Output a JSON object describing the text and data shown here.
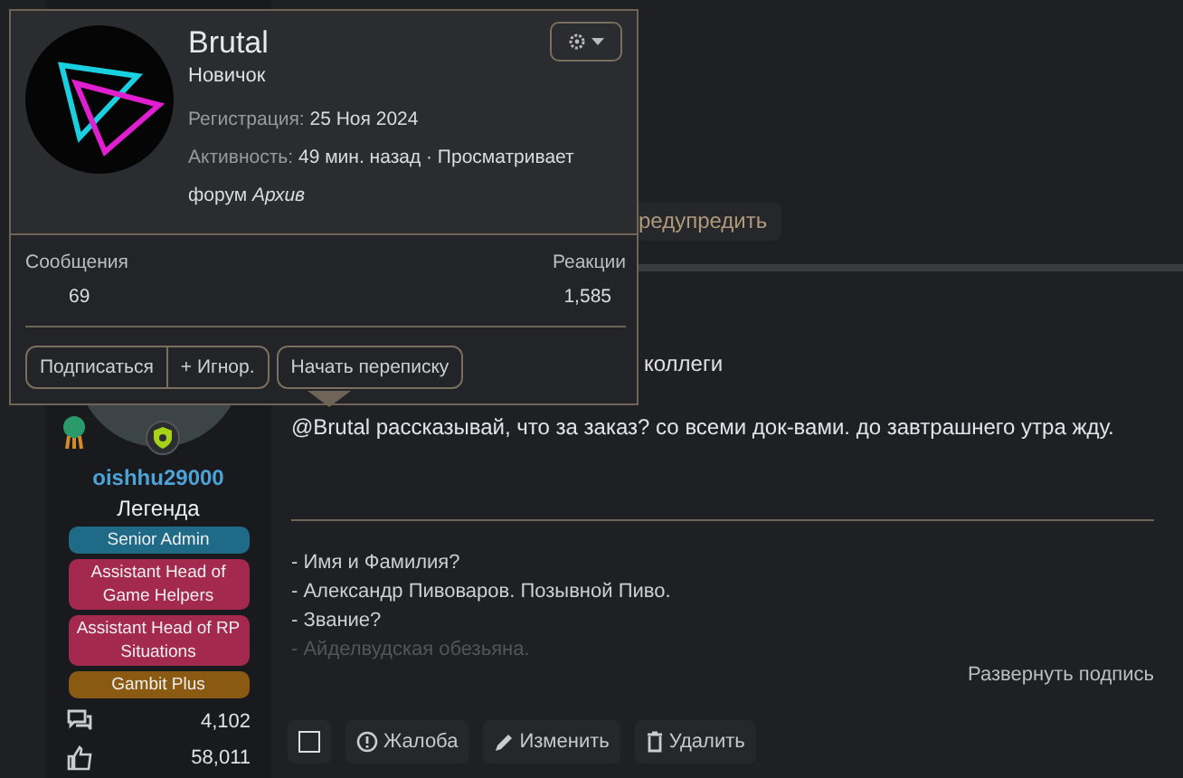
{
  "previous_post": {
    "actions": [
      {
        "label": "редупредить"
      }
    ]
  },
  "post": {
    "author": {
      "name": "oishhu29000",
      "title": "Легенда",
      "banners": [
        {
          "label": "Senior Admin",
          "color": "#1f6a86"
        },
        {
          "label": "Assistant Head of Game Helpers",
          "color": "#a3294f"
        },
        {
          "label": "Assistant Head of RP Situations",
          "color": "#a3294f"
        },
        {
          "label": "Gambit Plus",
          "color": "#8a5a12"
        }
      ],
      "stats": [
        {
          "kind": "messages",
          "value": "4,102"
        },
        {
          "kind": "likes",
          "value": "58,011"
        }
      ]
    },
    "text_fragment": "коллеги",
    "message": "@Brutal рассказывай, что за заказ? со всеми док-вами. до завтрашнего утра жду.",
    "signature": [
      {
        "text": "- Имя и Фамилия?",
        "faded": false
      },
      {
        "text": "- Александр Пивоваров. Позывной Пиво.",
        "faded": false
      },
      {
        "text": "- Звание?",
        "faded": false
      },
      {
        "text": "- Айделвудская обезьяна.",
        "faded": true
      }
    ],
    "expand_signature": "Развернуть подпись",
    "actions": [
      {
        "kind": "checkbox",
        "checked": false
      },
      {
        "kind": "report",
        "label": "Жалоба"
      },
      {
        "kind": "edit",
        "label": "Изменить"
      },
      {
        "kind": "delete",
        "label": "Удалить"
      }
    ]
  },
  "member_card": {
    "name": "Brutal",
    "title": "Новичок",
    "registration": {
      "label": "Регистрация:",
      "value": "25 Ноя 2024"
    },
    "activity": {
      "label": "Активность:",
      "value": "49 мин. назад · Просматривает форум *Архив*"
    },
    "stats": [
      {
        "label": "Сообщения",
        "value": "69"
      },
      {
        "label": "Реакции",
        "value": "1,585"
      }
    ],
    "button_group": [
      {
        "label": "Подписаться"
      },
      {
        "label": "+ Игнор."
      }
    ],
    "buttons": [
      {
        "label": "Начать переписку"
      }
    ]
  }
}
